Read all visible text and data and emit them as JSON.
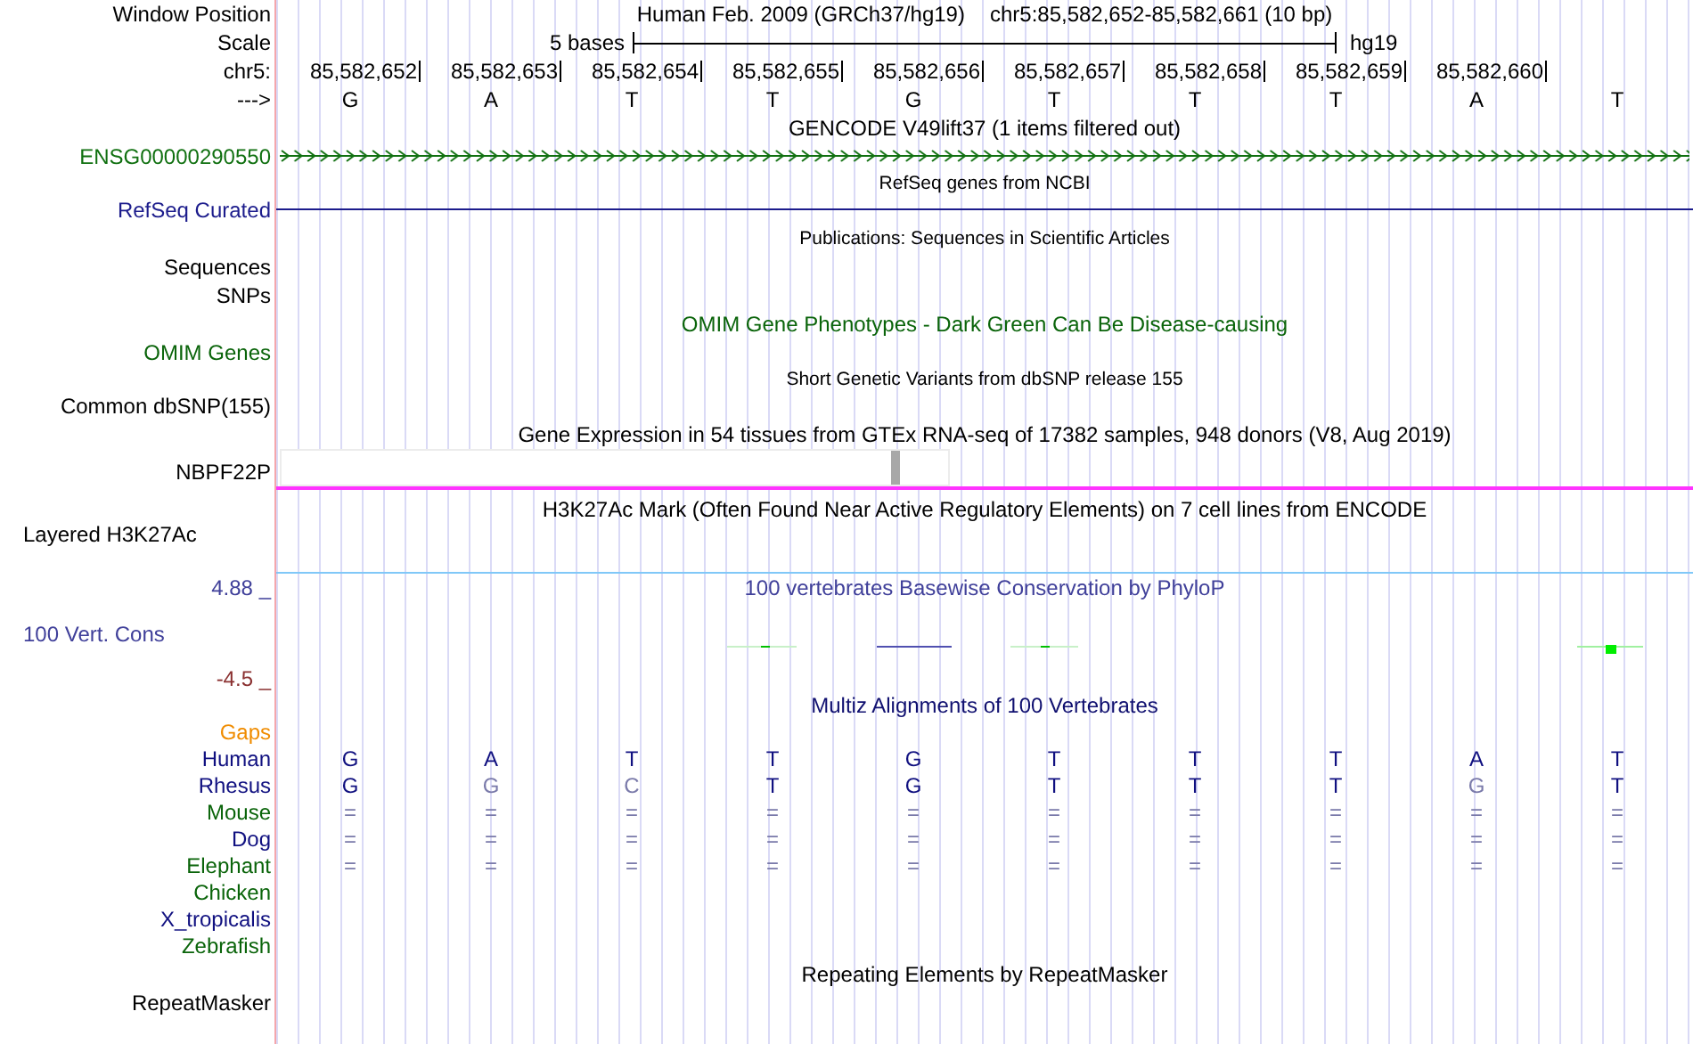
{
  "position": {
    "label": "Window Position",
    "assembly": "Human Feb. 2009 (GRCh37/hg19)",
    "range": "chr5:85,582,652-85,582,661 (10 bp)"
  },
  "scale": {
    "label": "Scale",
    "span": "5 bases",
    "assembly": "hg19"
  },
  "ruler": {
    "label": "chr5:",
    "positions": [
      "85,582,652",
      "85,582,653",
      "85,582,654",
      "85,582,655",
      "85,582,656",
      "85,582,657",
      "85,582,658",
      "85,582,659",
      "85,582,660"
    ]
  },
  "sequence": {
    "label": "--->",
    "bases": [
      "G",
      "A",
      "T",
      "T",
      "G",
      "T",
      "T",
      "T",
      "A",
      "T"
    ]
  },
  "tracks": [
    {
      "kind": "gene_arrows",
      "title": "GENCODE V49lift37 (1 items filtered out)",
      "labels": [
        {
          "text": "ENSG00000290550",
          "color": "#107010"
        }
      ]
    },
    {
      "kind": "gene_line",
      "title": "RefSeq genes from NCBI",
      "labels": [
        {
          "text": "RefSeq Curated",
          "color": "#1c1c8c"
        }
      ]
    },
    {
      "kind": "publications",
      "title": "Publications: Sequences in Scientific Articles",
      "labels": [
        {
          "text": "Sequences",
          "color": "#000000"
        },
        {
          "text": "SNPs",
          "color": "#000000"
        }
      ]
    },
    {
      "kind": "omim",
      "title": "OMIM Gene Phenotypes - Dark Green Can Be Disease-causing",
      "labels": [
        {
          "text": "OMIM Genes",
          "color": "#0a640a"
        }
      ]
    },
    {
      "kind": "variants",
      "title": "Short Genetic Variants from dbSNP release 155",
      "labels": [
        {
          "text": "Common dbSNP(155)",
          "color": "#000000"
        }
      ]
    },
    {
      "kind": "expression",
      "title": "Gene Expression in 54 tissues from GTEx RNA-seq of 17382 samples, 948 donors (V8, Aug 2019)",
      "labels": [
        {
          "text": "NBPF22P",
          "color": "#000000"
        }
      ]
    },
    {
      "kind": "signal",
      "title": "H3K27Ac Mark (Often Found Near Active Regulatory Elements) on 7 cell lines from ENCODE",
      "labels": [
        {
          "text": "Layered H3K27Ac",
          "color": "#000000"
        }
      ]
    },
    {
      "kind": "conservation",
      "title": "100 vertebrates Basewise Conservation by PhyloP",
      "labels": [
        {
          "text": "4.88 _",
          "color": "#40409a"
        },
        {
          "text": "100 Vert. Cons",
          "color": "#40409a"
        },
        {
          "text": "-4.5 _",
          "color": "#8a3030"
        }
      ]
    },
    {
      "kind": "alignment",
      "title": "Multiz Alignments of 100 Vertebrates",
      "rows": [
        {
          "species": "Gaps",
          "color": "#f08c00"
        },
        {
          "species": "Human",
          "color": "#101080",
          "bases": [
            {
              "text": "G",
              "faded": false
            },
            {
              "text": "A",
              "faded": false
            },
            {
              "text": "T",
              "faded": false
            },
            {
              "text": "T",
              "faded": false
            },
            {
              "text": "G",
              "faded": false
            },
            {
              "text": "T",
              "faded": false
            },
            {
              "text": "T",
              "faded": false
            },
            {
              "text": "T",
              "faded": false
            },
            {
              "text": "A",
              "faded": false
            },
            {
              "text": "T",
              "faded": false
            }
          ]
        },
        {
          "species": "Rhesus",
          "color": "#101080",
          "bases": [
            {
              "text": "G",
              "faded": false
            },
            {
              "text": "G",
              "faded": true
            },
            {
              "text": "C",
              "faded": true
            },
            {
              "text": "T",
              "faded": false
            },
            {
              "text": "G",
              "faded": false
            },
            {
              "text": "T",
              "faded": false
            },
            {
              "text": "T",
              "faded": false
            },
            {
              "text": "T",
              "faded": false
            },
            {
              "text": "G",
              "faded": true
            },
            {
              "text": "T",
              "faded": false
            }
          ]
        },
        {
          "species": "Mouse",
          "color": "#0a640a",
          "bases": [
            {
              "text": "=",
              "faded": true
            },
            {
              "text": "=",
              "faded": true
            },
            {
              "text": "=",
              "faded": true
            },
            {
              "text": "=",
              "faded": true
            },
            {
              "text": "=",
              "faded": true
            },
            {
              "text": "=",
              "faded": true
            },
            {
              "text": "=",
              "faded": true
            },
            {
              "text": "=",
              "faded": true
            },
            {
              "text": "=",
              "faded": true
            },
            {
              "text": "=",
              "faded": true
            }
          ]
        },
        {
          "species": "Dog",
          "color": "#101080",
          "bases": [
            {
              "text": "=",
              "faded": true
            },
            {
              "text": "=",
              "faded": true
            },
            {
              "text": "=",
              "faded": true
            },
            {
              "text": "=",
              "faded": true
            },
            {
              "text": "=",
              "faded": true
            },
            {
              "text": "=",
              "faded": true
            },
            {
              "text": "=",
              "faded": true
            },
            {
              "text": "=",
              "faded": true
            },
            {
              "text": "=",
              "faded": true
            },
            {
              "text": "=",
              "faded": true
            }
          ]
        },
        {
          "species": "Elephant",
          "color": "#0a640a",
          "bases": [
            {
              "text": "=",
              "faded": true
            },
            {
              "text": "=",
              "faded": true
            },
            {
              "text": "=",
              "faded": true
            },
            {
              "text": "=",
              "faded": true
            },
            {
              "text": "=",
              "faded": true
            },
            {
              "text": "=",
              "faded": true
            },
            {
              "text": "=",
              "faded": true
            },
            {
              "text": "=",
              "faded": true
            },
            {
              "text": "=",
              "faded": true
            },
            {
              "text": "=",
              "faded": true
            }
          ]
        },
        {
          "species": "Chicken",
          "color": "#0a640a"
        },
        {
          "species": "X_tropicalis",
          "color": "#101080"
        },
        {
          "species": "Zebrafish",
          "color": "#0a640a"
        }
      ]
    },
    {
      "kind": "repeats",
      "title": "Repeating Elements by RepeatMasker",
      "labels": [
        {
          "text": "RepeatMasker",
          "color": "#000000"
        }
      ]
    }
  ]
}
